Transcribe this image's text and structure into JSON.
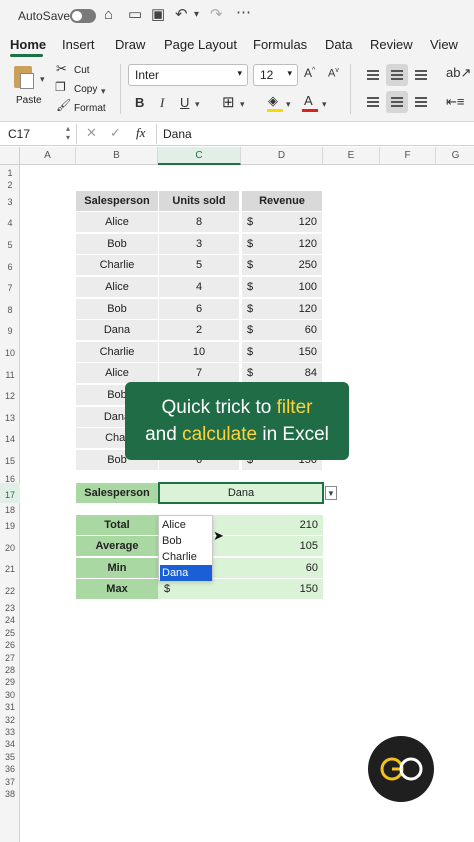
{
  "titlebar": {
    "autosave_label": "AutoSave",
    "icons": [
      "toggle-off",
      "home-icon",
      "file-icon",
      "save-icon",
      "undo-icon",
      "chevron-down-icon",
      "redo-icon",
      "more-icon"
    ]
  },
  "tabs": [
    "Home",
    "Insert",
    "Draw",
    "Page Layout",
    "Formulas",
    "Data",
    "Review",
    "View"
  ],
  "ribbon": {
    "paste_label": "Paste",
    "cut_label": "Cut",
    "copy_label": "Copy",
    "format_label": "Format",
    "font_name": "Inter",
    "font_size": "12",
    "bold": "B",
    "italic": "I",
    "underline": "U"
  },
  "formula_bar": {
    "cell_ref": "C17",
    "fx": "fx",
    "value": "Dana"
  },
  "columns": [
    "A",
    "B",
    "C",
    "D",
    "E",
    "F",
    "G"
  ],
  "rows": [
    "1",
    "2",
    "3",
    "4",
    "5",
    "6",
    "7",
    "8",
    "9",
    "10",
    "11",
    "12",
    "13",
    "14",
    "15",
    "16",
    "17",
    "18",
    "19",
    "20",
    "21",
    "22",
    "23",
    "24",
    "25",
    "26",
    "27",
    "28",
    "29",
    "30",
    "31",
    "32",
    "33",
    "34",
    "35",
    "36",
    "37",
    "38"
  ],
  "table": {
    "headers": [
      "Salesperson",
      "Units sold",
      "Revenue"
    ],
    "currency": "$",
    "rows": [
      {
        "name": "Alice",
        "units": "8",
        "revenue": "120"
      },
      {
        "name": "Bob",
        "units": "3",
        "revenue": "120"
      },
      {
        "name": "Charlie",
        "units": "5",
        "revenue": "250"
      },
      {
        "name": "Alice",
        "units": "4",
        "revenue": "100"
      },
      {
        "name": "Bob",
        "units": "6",
        "revenue": "120"
      },
      {
        "name": "Dana",
        "units": "2",
        "revenue": "60"
      },
      {
        "name": "Charlie",
        "units": "10",
        "revenue": "150"
      },
      {
        "name": "Alice",
        "units": "7",
        "revenue": "84"
      },
      {
        "name": "Bob",
        "units": "",
        "revenue": ""
      },
      {
        "name": "Dana",
        "units": "",
        "revenue": ""
      },
      {
        "name": "Char",
        "units": "",
        "revenue": ""
      },
      {
        "name": "Bob",
        "units": "6",
        "revenue": "150"
      }
    ]
  },
  "filter": {
    "label": "Salesperson",
    "value": "Dana"
  },
  "dropdown": {
    "options": [
      "Alice",
      "Bob",
      "Charlie",
      "Dana"
    ],
    "selected": "Dana"
  },
  "summary": [
    {
      "label": "Total",
      "currency": "",
      "value": "210"
    },
    {
      "label": "Average",
      "currency": "",
      "value": "105"
    },
    {
      "label": "Min",
      "currency": "$",
      "value": "60"
    },
    {
      "label": "Max",
      "currency": "$",
      "value": "150"
    }
  ],
  "banner": {
    "line1_a": "Quick trick to ",
    "line1_b": "filter",
    "line2_a": "and ",
    "line2_b": "calculate",
    "line2_c": " in Excel"
  },
  "colors": {
    "accent": "#1e7145",
    "banner_bg": "#1f6c46",
    "highlight": "#ffd33a"
  }
}
